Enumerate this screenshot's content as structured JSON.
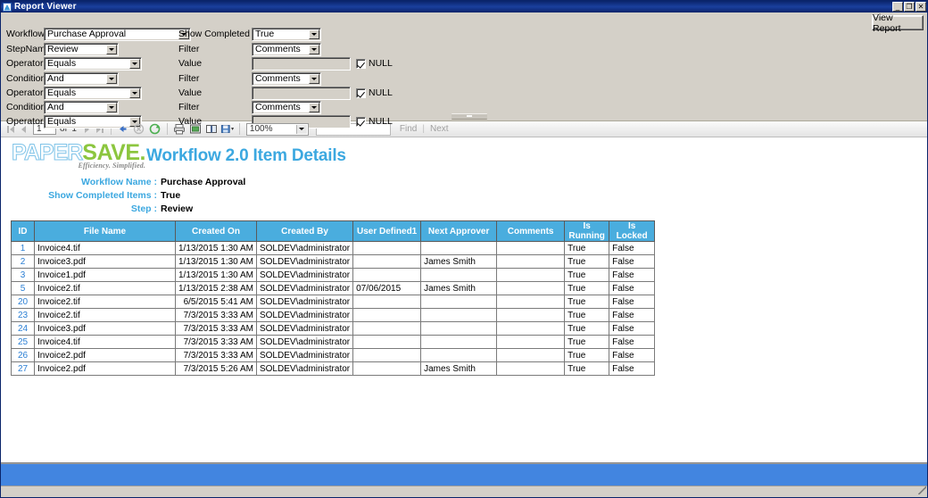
{
  "window": {
    "title": "Report Viewer",
    "icon": "report-window-icon",
    "controls": {
      "minimize": "_",
      "restore": "❐",
      "close": "✕"
    }
  },
  "parameters": {
    "view_report_label": "View Report",
    "left_fields": [
      {
        "label": "Workflow",
        "value": "Purchase Approval",
        "type": "combo",
        "width": 165
      },
      {
        "label": "StepName",
        "value": "Review",
        "type": "combo",
        "width": 84
      },
      {
        "label": "Operator",
        "value": "Equals",
        "type": "combo",
        "width": 110
      },
      {
        "label": "Condition",
        "value": "And",
        "type": "combo",
        "width": 84
      },
      {
        "label": "Operator",
        "value": "Equals",
        "type": "combo",
        "width": 110
      },
      {
        "label": "Condition",
        "value": "And",
        "type": "combo",
        "width": 84
      },
      {
        "label": "Operator",
        "value": "Equals",
        "type": "combo",
        "width": 110
      }
    ],
    "right_fields": [
      {
        "label": "Show Completed Items",
        "value": "True",
        "type": "combo",
        "width": 78
      },
      {
        "label": "Filter",
        "value": "Comments",
        "type": "combo",
        "width": 78
      },
      {
        "label": "Value",
        "value": "",
        "type": "text",
        "width": 111,
        "null_label": "NULL",
        "null_checked": true
      },
      {
        "label": "Filter",
        "value": "Comments",
        "type": "combo",
        "width": 78
      },
      {
        "label": "Value",
        "value": "",
        "type": "text",
        "width": 111,
        "null_label": "NULL",
        "null_checked": true
      },
      {
        "label": "Filter",
        "value": "Comments",
        "type": "combo",
        "width": 78
      },
      {
        "label": "Value",
        "value": "",
        "type": "text",
        "width": 111,
        "null_label": "NULL",
        "null_checked": true
      }
    ]
  },
  "toolbar": {
    "current_page": "1",
    "of_label": "of",
    "total_pages": "1",
    "zoom": "100%",
    "find_label": "Find",
    "find_separator": "|",
    "next_label": "Next",
    "search_value": "",
    "icons": [
      "first-page-icon",
      "previous-page-icon",
      "next-page-icon",
      "last-page-icon",
      "back-icon",
      "stop-icon",
      "refresh-icon",
      "print-icon",
      "print-layout-icon",
      "page-setup-icon",
      "export-icon"
    ]
  },
  "report": {
    "logo": {
      "word1": "PAPER",
      "word2": "SAVE.",
      "tagline": "Efficiency. Simplified."
    },
    "title": "Workflow 2.0 Item Details",
    "meta": [
      {
        "label": "Workflow Name :",
        "value": "Purchase Approval"
      },
      {
        "label": "Show Completed Items :",
        "value": "True"
      },
      {
        "label": "Step :",
        "value": "Review"
      }
    ],
    "table": {
      "columns": [
        "ID",
        "File Name",
        "Created On",
        "Created By",
        "User Defined1",
        "Next Approver",
        "Comments",
        "Is Running",
        "Is Locked"
      ],
      "rows": [
        {
          "id": "1",
          "file": "Invoice4.tif",
          "created_on": "1/13/2015 1:30 AM",
          "created_by": "SOLDEV\\administrator",
          "ud1": "",
          "approver": "",
          "comments": "",
          "running": "True",
          "locked": "False"
        },
        {
          "id": "2",
          "file": "Invoice3.pdf",
          "created_on": "1/13/2015 1:30 AM",
          "created_by": "SOLDEV\\administrator",
          "ud1": "",
          "approver": "James Smith",
          "comments": "",
          "running": "True",
          "locked": "False"
        },
        {
          "id": "3",
          "file": "Invoice1.pdf",
          "created_on": "1/13/2015 1:30 AM",
          "created_by": "SOLDEV\\administrator",
          "ud1": "",
          "approver": "",
          "comments": "",
          "running": "True",
          "locked": "False"
        },
        {
          "id": "5",
          "file": "Invoice2.tif",
          "created_on": "1/13/2015 2:38 AM",
          "created_by": "SOLDEV\\administrator",
          "ud1": "07/06/2015",
          "approver": "James Smith",
          "comments": "",
          "running": "True",
          "locked": "False"
        },
        {
          "id": "20",
          "file": "Invoice2.tif",
          "created_on": "6/5/2015 5:41 AM",
          "created_by": "SOLDEV\\administrator",
          "ud1": "",
          "approver": "",
          "comments": "",
          "running": "True",
          "locked": "False"
        },
        {
          "id": "23",
          "file": "Invoice2.tif",
          "created_on": "7/3/2015 3:33 AM",
          "created_by": "SOLDEV\\administrator",
          "ud1": "",
          "approver": "",
          "comments": "",
          "running": "True",
          "locked": "False"
        },
        {
          "id": "24",
          "file": "Invoice3.pdf",
          "created_on": "7/3/2015 3:33 AM",
          "created_by": "SOLDEV\\administrator",
          "ud1": "",
          "approver": "",
          "comments": "",
          "running": "True",
          "locked": "False"
        },
        {
          "id": "25",
          "file": "Invoice4.tif",
          "created_on": "7/3/2015 3:33 AM",
          "created_by": "SOLDEV\\administrator",
          "ud1": "",
          "approver": "",
          "comments": "",
          "running": "True",
          "locked": "False"
        },
        {
          "id": "26",
          "file": "Invoice2.pdf",
          "created_on": "7/3/2015 3:33 AM",
          "created_by": "SOLDEV\\administrator",
          "ud1": "",
          "approver": "",
          "comments": "",
          "running": "True",
          "locked": "False"
        },
        {
          "id": "27",
          "file": "Invoice2.pdf",
          "created_on": "7/3/2015 5:26 AM",
          "created_by": "SOLDEV\\administrator",
          "ud1": "",
          "approver": "James Smith",
          "comments": "",
          "running": "True",
          "locked": "False"
        }
      ]
    }
  },
  "colors": {
    "title_blue": "#3ca8e0",
    "header_blue": "#4aadde",
    "logo_green": "#8cc63f",
    "logo_blue": "#7ec3e8",
    "status_blue": "#4285e0",
    "id_link": "#2b7fd4",
    "window_chrome": "#d4d0c8"
  }
}
